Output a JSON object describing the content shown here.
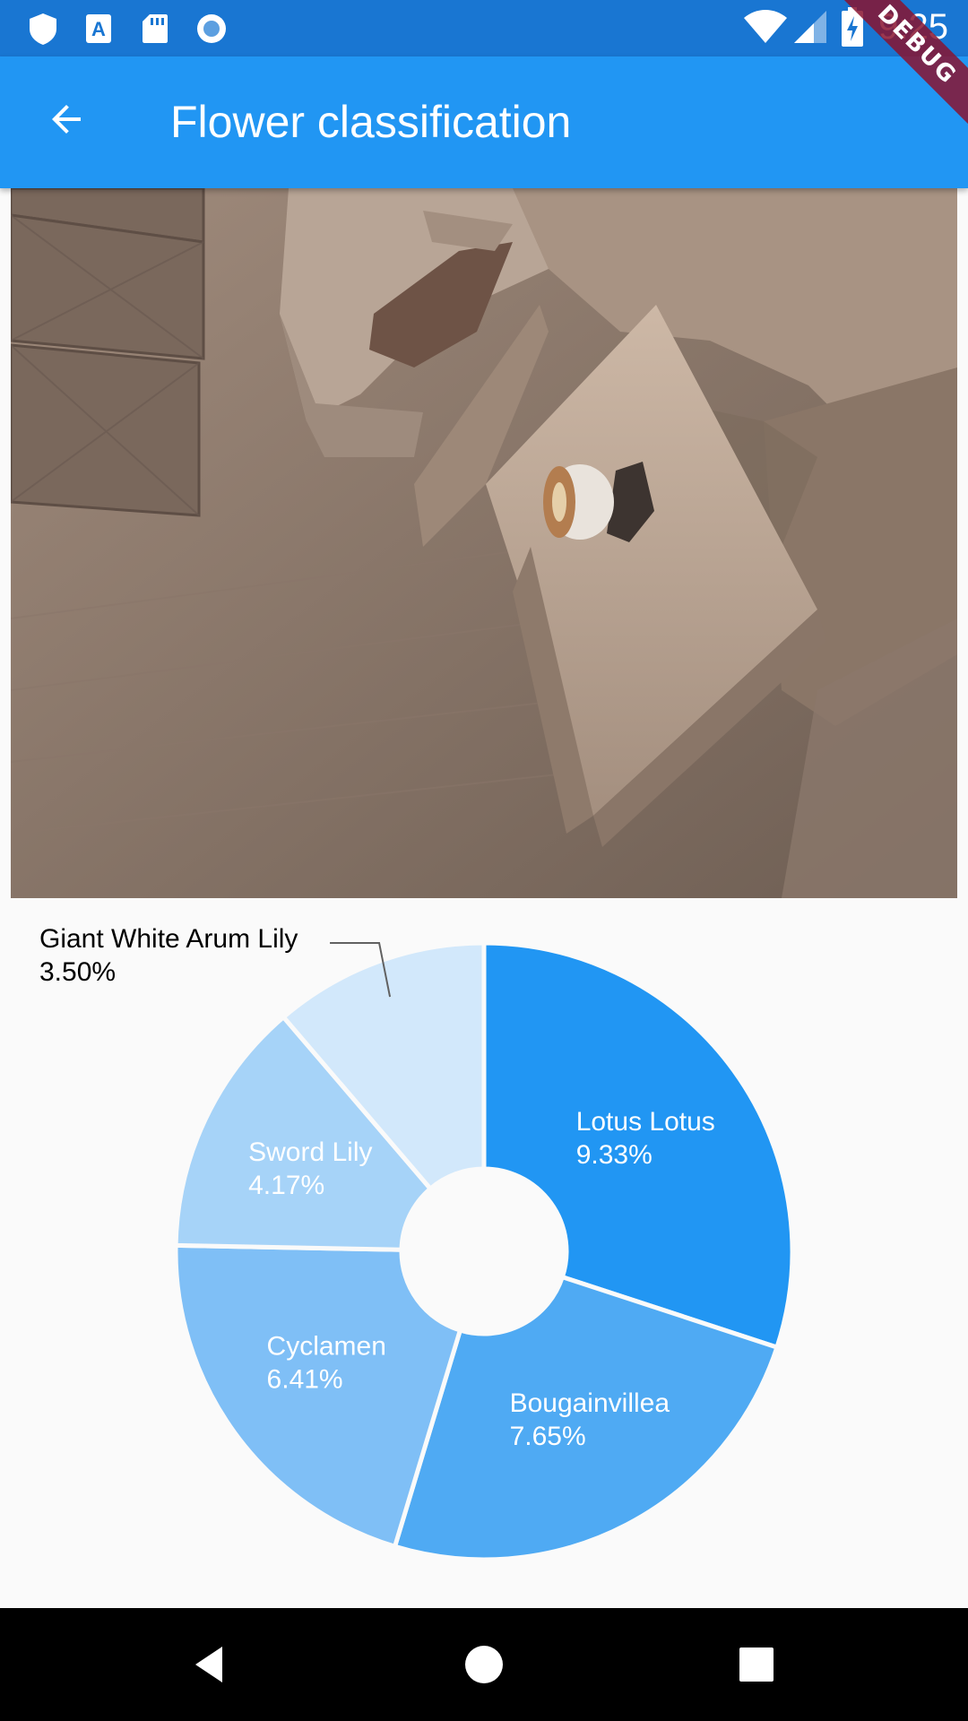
{
  "status_bar": {
    "time": "9:25",
    "left_icons": [
      "shield-icon",
      "font-download-icon",
      "sd-card-icon",
      "radio-button-icon"
    ],
    "right_icons": [
      "wifi-icon",
      "cell-signal-icon",
      "battery-charging-icon"
    ]
  },
  "debug_banner": "DEBUG",
  "app_bar": {
    "title": "Flower classification",
    "back_icon": "arrow-back-icon",
    "color": "#2196f3"
  },
  "chart_data": {
    "type": "pie",
    "donut": true,
    "slices": [
      {
        "label": "Lotus Lotus",
        "value": 9.33,
        "display": "9.33%",
        "color": "#2196f3"
      },
      {
        "label": "Bougainvillea",
        "value": 7.65,
        "display": "7.65%",
        "color": "#4faaf3"
      },
      {
        "label": "Cyclamen",
        "value": 6.41,
        "display": "6.41%",
        "color": "#7fbff6"
      },
      {
        "label": "Sword Lily",
        "value": 4.17,
        "display": "4.17%",
        "color": "#a6d3f8"
      },
      {
        "label": "Giant White Arum Lily",
        "value": 3.5,
        "display": "3.50%",
        "color": "#d2e8fb",
        "label_outside": true
      }
    ]
  },
  "nav_bar": {
    "back_icon": "nav-back-icon",
    "home_icon": "nav-home-icon",
    "recents_icon": "nav-recents-icon"
  }
}
